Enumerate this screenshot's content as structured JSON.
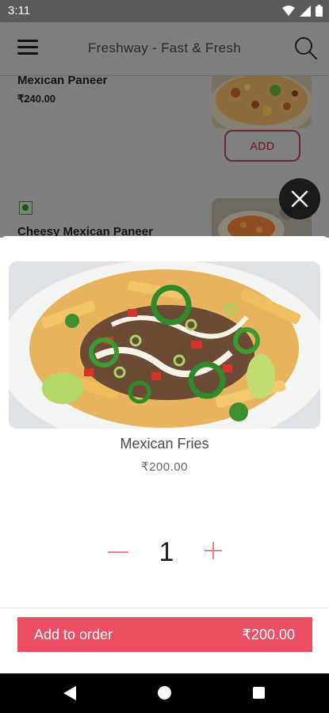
{
  "status_bar": {
    "time": "3:11",
    "icons": [
      "wifi-icon",
      "signal-icon",
      "battery-icon"
    ]
  },
  "app_bar": {
    "title": "Freshway - Fast & Fresh",
    "menu_icon": "hamburger-menu-icon",
    "search_icon": "search-icon"
  },
  "background_list": {
    "items": [
      {
        "name": "Mexican Paneer",
        "price": "₹240.00",
        "add_label": "ADD"
      },
      {
        "name": "Cheesy Mexican Paneer",
        "veg_icon": "veg-indicator-icon"
      }
    ]
  },
  "close_icon": "close-icon",
  "product": {
    "name": "Mexican Fries",
    "price": "₹200.00",
    "quantity": "1",
    "minus_icon": "minus-icon",
    "plus_icon": "plus-icon"
  },
  "order_button": {
    "label": "Add to order",
    "total": "₹200.00"
  },
  "nav_bar": {
    "icons": [
      "back-icon",
      "home-icon",
      "recents-icon"
    ]
  },
  "colors": {
    "accent": "#ec4e63",
    "stepper": "#ee7f8d",
    "scrim": "#7f7f7f"
  }
}
